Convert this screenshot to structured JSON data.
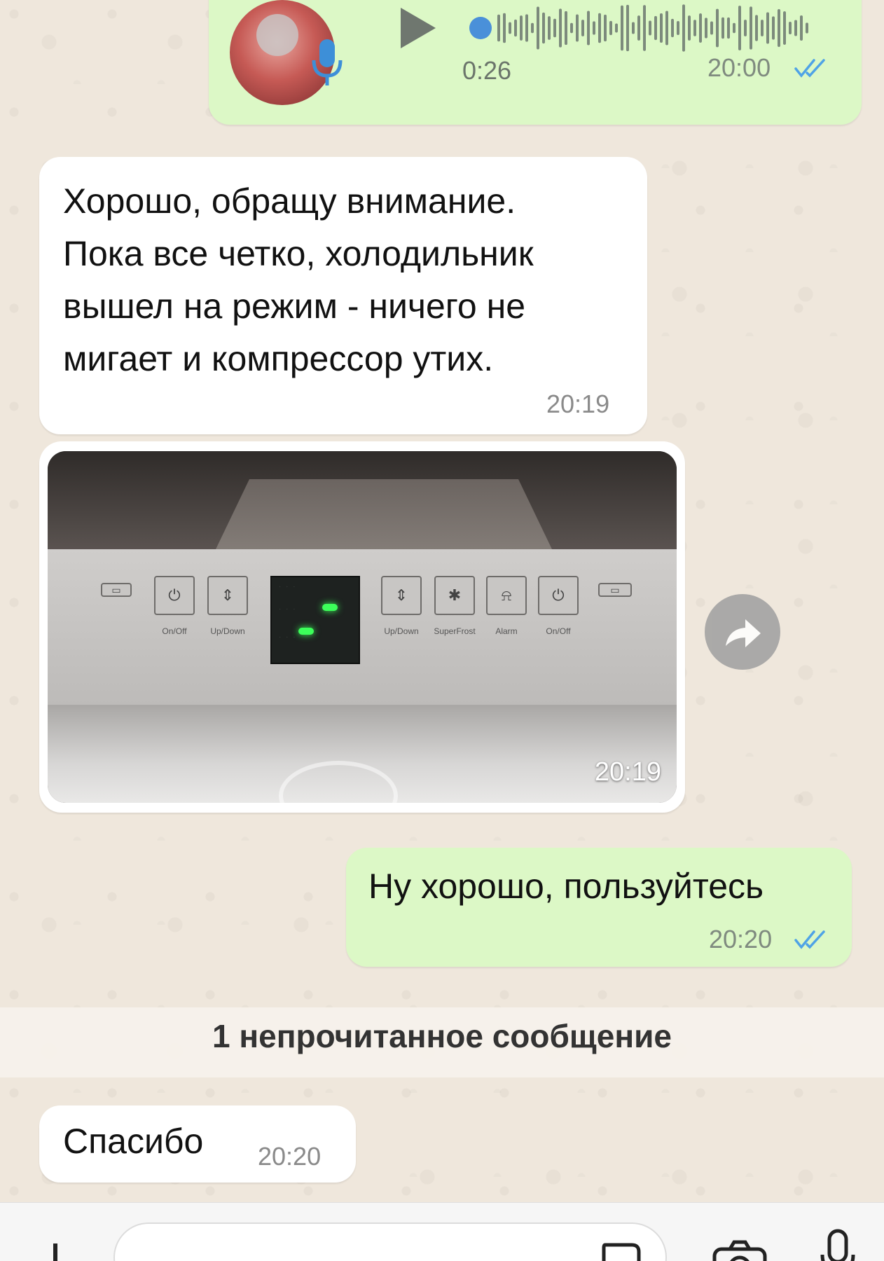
{
  "colors": {
    "incoming_bubble": "#ffffff",
    "outgoing_bubble": "#dcf8c6",
    "read_ticks": "#4fa3e6",
    "voice_accent": "#4a90d9"
  },
  "messages": {
    "voice": {
      "duration": "0:26",
      "time": "20:00",
      "status": "read"
    },
    "text1": {
      "lines": [
        "Хорошо, обращу внимание.",
        "Пока все четко, холодильник",
        "вышел на режим - ничего не",
        "мигает и компрессор утих."
      ],
      "time": "20:19"
    },
    "photo": {
      "time": "20:19",
      "panel_buttons": [
        {
          "icon": "power-icon",
          "label": "On/Off"
        },
        {
          "icon": "updown-icon",
          "label": "Up/Down"
        },
        {
          "icon": "updown-icon",
          "label": "Up/Down"
        },
        {
          "icon": "superfrost-icon",
          "label": "SuperFrost"
        },
        {
          "icon": "alarm-icon",
          "label": "Alarm"
        },
        {
          "icon": "power-icon",
          "label": "On/Off"
        }
      ]
    },
    "text2": {
      "text": "Ну хорошо, пользуйтесь",
      "time": "20:20",
      "status": "read"
    },
    "unread_divider": "1 непрочитанное сообщение",
    "text3": {
      "text": "Спасибо",
      "time": "20:20"
    }
  },
  "input_bar": {
    "icons": [
      "plus-icon",
      "sticker-icon",
      "camera-icon",
      "microphone-icon"
    ]
  }
}
